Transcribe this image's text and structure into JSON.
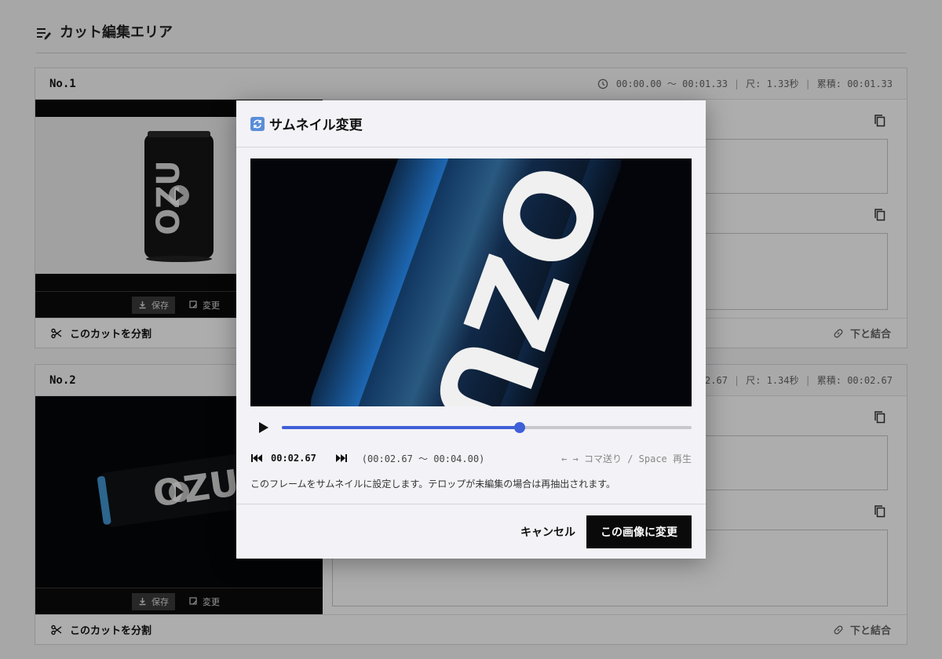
{
  "section": {
    "title": "カット編集エリア",
    "icon": "edit-list-icon"
  },
  "cuts": [
    {
      "number": "No.1",
      "time_range": "00:00.00 ～ 00:01.33",
      "length": "尺: 1.33秒",
      "cumulative": "累積: 00:01.33",
      "save_label": "保存",
      "change_label": "変更",
      "split_label": "このカットを分割",
      "merge_label": "下と結合"
    },
    {
      "number": "No.2",
      "time_range": "2.67",
      "length": "尺: 1.34秒",
      "cumulative": "累積: 00:02.67",
      "save_label": "保存",
      "change_label": "変更",
      "split_label": "このカットを分割",
      "merge_label": "下と結合"
    }
  ],
  "modal": {
    "title": "サムネイル変更",
    "title_icon": "refresh-icon",
    "current_time": "00:02.67",
    "range_text": "(00:02.67 〜 00:04.00)",
    "hint": "← → コマ送り / Space 再生",
    "progress": 0.58,
    "description": "このフレームをサムネイルに設定します。テロップが未編集の場合は再抽出されます。",
    "cancel_label": "キャンセル",
    "confirm_label": "この画像に変更",
    "can_text": "OZU",
    "accent_color": "#3f5fd8"
  },
  "thumbnails": {
    "can_text": "OZU"
  },
  "separator": "|"
}
